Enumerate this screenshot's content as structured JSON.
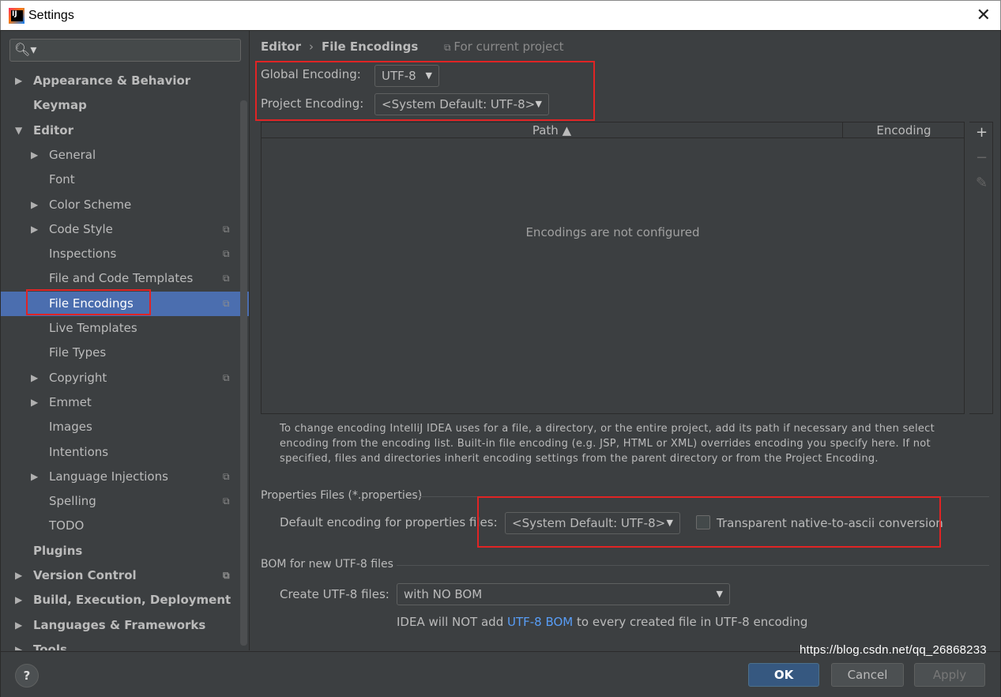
{
  "window": {
    "title": "Settings",
    "close_glyph": "✕"
  },
  "search": {
    "placeholder": "",
    "icon": "search-icon"
  },
  "sidebar": {
    "items": [
      {
        "label": "Appearance & Behavior",
        "indent": 0,
        "arrow": "▶",
        "bold": true,
        "copy": false
      },
      {
        "label": "Keymap",
        "indent": 0,
        "arrow": "",
        "bold": true,
        "copy": false
      },
      {
        "label": "Editor",
        "indent": 0,
        "arrow": "▼",
        "bold": true,
        "copy": false
      },
      {
        "label": "General",
        "indent": 1,
        "arrow": "▶",
        "bold": false,
        "copy": false
      },
      {
        "label": "Font",
        "indent": 1,
        "arrow": "",
        "bold": false,
        "copy": false
      },
      {
        "label": "Color Scheme",
        "indent": 1,
        "arrow": "▶",
        "bold": false,
        "copy": false
      },
      {
        "label": "Code Style",
        "indent": 1,
        "arrow": "▶",
        "bold": false,
        "copy": true
      },
      {
        "label": "Inspections",
        "indent": 1,
        "arrow": "",
        "bold": false,
        "copy": true
      },
      {
        "label": "File and Code Templates",
        "indent": 1,
        "arrow": "",
        "bold": false,
        "copy": true
      },
      {
        "label": "File Encodings",
        "indent": 1,
        "arrow": "",
        "bold": false,
        "copy": true,
        "selected": true
      },
      {
        "label": "Live Templates",
        "indent": 1,
        "arrow": "",
        "bold": false,
        "copy": false
      },
      {
        "label": "File Types",
        "indent": 1,
        "arrow": "",
        "bold": false,
        "copy": false
      },
      {
        "label": "Copyright",
        "indent": 1,
        "arrow": "▶",
        "bold": false,
        "copy": true
      },
      {
        "label": "Emmet",
        "indent": 1,
        "arrow": "▶",
        "bold": false,
        "copy": false
      },
      {
        "label": "Images",
        "indent": 1,
        "arrow": "",
        "bold": false,
        "copy": false
      },
      {
        "label": "Intentions",
        "indent": 1,
        "arrow": "",
        "bold": false,
        "copy": false
      },
      {
        "label": "Language Injections",
        "indent": 1,
        "arrow": "▶",
        "bold": false,
        "copy": true
      },
      {
        "label": "Spelling",
        "indent": 1,
        "arrow": "",
        "bold": false,
        "copy": true
      },
      {
        "label": "TODO",
        "indent": 1,
        "arrow": "",
        "bold": false,
        "copy": false
      },
      {
        "label": "Plugins",
        "indent": 0,
        "arrow": "",
        "bold": true,
        "copy": false
      },
      {
        "label": "Version Control",
        "indent": 0,
        "arrow": "▶",
        "bold": true,
        "copy": true
      },
      {
        "label": "Build, Execution, Deployment",
        "indent": 0,
        "arrow": "▶",
        "bold": true,
        "copy": false
      },
      {
        "label": "Languages & Frameworks",
        "indent": 0,
        "arrow": "▶",
        "bold": true,
        "copy": false
      },
      {
        "label": "Tools",
        "indent": 0,
        "arrow": "▶",
        "bold": true,
        "copy": false
      }
    ]
  },
  "breadcrumb": {
    "parent": "Editor",
    "separator": "›",
    "current": "File Encodings"
  },
  "scope": "For current project",
  "global_encoding": {
    "label": "Global Encoding:",
    "value": "UTF-8"
  },
  "project_encoding": {
    "label": "Project Encoding:",
    "value": "<System Default: UTF-8>"
  },
  "table": {
    "columns": [
      "Path ▲",
      "Encoding"
    ],
    "empty_text": "Encodings are not configured",
    "tools": [
      "+",
      "−",
      "✎"
    ]
  },
  "help_text": "To change encoding IntelliJ IDEA uses for a file, a directory, or the entire project, add its path if necessary and then select encoding from the encoding list. Built-in file encoding (e.g. JSP, HTML or XML) overrides encoding you specify here. If not specified, files and directories inherit encoding settings from the parent directory or from the Project Encoding.",
  "properties": {
    "section_title": "Properties Files (*.properties)",
    "label": "Default encoding for properties files:",
    "value": "<System Default: UTF-8>",
    "checkbox_label": "Transparent native-to-ascii conversion",
    "checked": false
  },
  "bom": {
    "section_title": "BOM for new UTF-8 files",
    "label": "Create UTF-8 files:",
    "value": "with NO BOM",
    "note_prefix": "IDEA will NOT add ",
    "note_link": "UTF-8 BOM",
    "note_suffix": " to every created file in UTF-8 encoding"
  },
  "buttons": {
    "help": "?",
    "ok": "OK",
    "cancel": "Cancel",
    "apply": "Apply"
  },
  "watermark": "https://blog.csdn.net/qq_26868233",
  "colors": {
    "background": "#3c3f41",
    "selection": "#4b6eaf",
    "highlight_box": "#e02424",
    "link": "#589df6",
    "primary_button": "#365880"
  }
}
